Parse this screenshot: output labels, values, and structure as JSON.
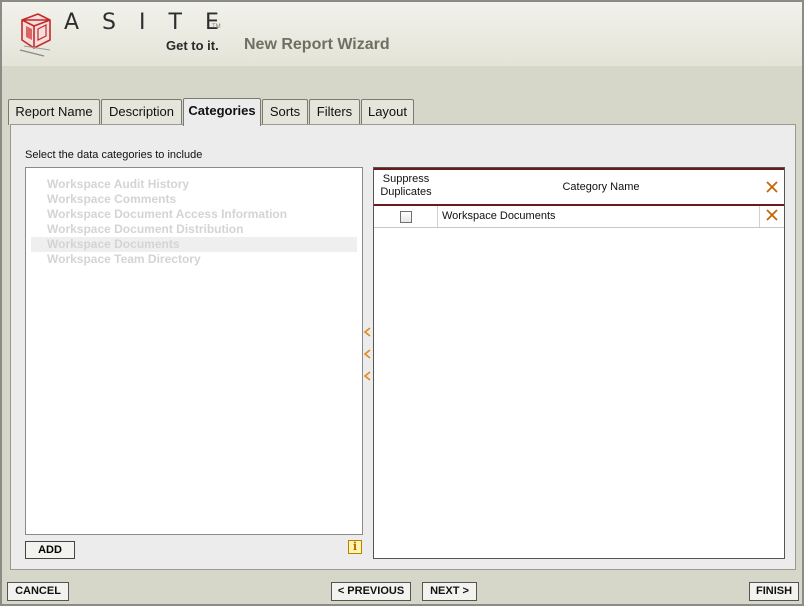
{
  "header": {
    "logo_letters": "ASITE",
    "logo_tm": "TM",
    "tagline": "Get to it.",
    "title": "New Report Wizard"
  },
  "tabs": [
    {
      "label": "Report Name",
      "active": false
    },
    {
      "label": "Description",
      "active": false
    },
    {
      "label": "Categories",
      "active": true
    },
    {
      "label": "Sorts",
      "active": false
    },
    {
      "label": "Filters",
      "active": false
    },
    {
      "label": "Layout",
      "active": false
    }
  ],
  "categories": {
    "instruction": "Select the data categories to include",
    "available": [
      {
        "label": "Workspace Audit History",
        "selected": false
      },
      {
        "label": "Workspace Comments",
        "selected": false
      },
      {
        "label": "Workspace Document Access Information",
        "selected": false
      },
      {
        "label": "Workspace Document Distribution",
        "selected": false
      },
      {
        "label": "Workspace Documents",
        "selected": true
      },
      {
        "label": "Workspace Team Directory",
        "selected": false
      }
    ],
    "add_label": "ADD",
    "info_icon_glyph": "i",
    "table": {
      "header_suppress": "Suppress Duplicates",
      "header_category": "Category Name",
      "rows": [
        {
          "suppress_duplicates": false,
          "category": "Workspace Documents"
        }
      ]
    }
  },
  "footer": {
    "cancel_label": "CANCEL",
    "previous_label": "< PREVIOUS",
    "next_label": "NEXT >",
    "finish_label": "FINISH"
  },
  "colors": {
    "accent_arrow": "#e08a1e",
    "remove_icon": "#c86400",
    "header_rule": "#6b1a1a",
    "disabled_text": "#d4d4d4",
    "title_text": "#6f6f62"
  }
}
